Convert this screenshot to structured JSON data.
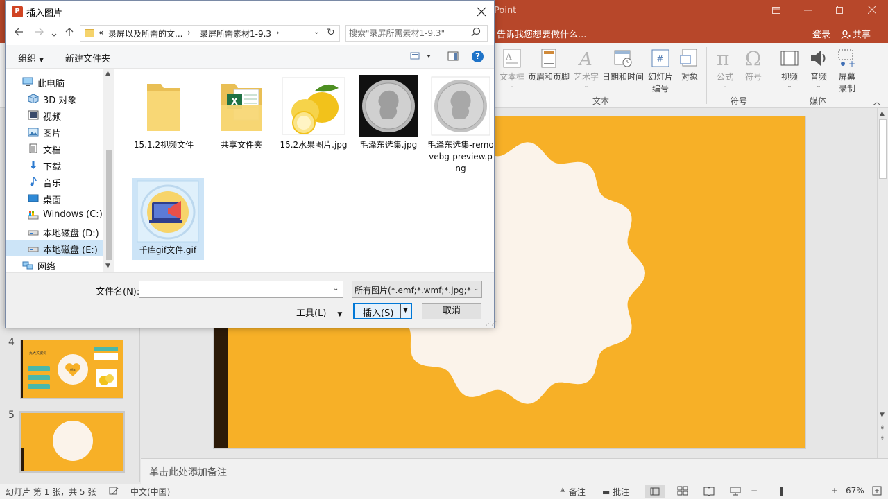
{
  "ppt": {
    "app_title_fragment": "Point",
    "tell_me": "告诉我您想要做什么...",
    "login": "登录",
    "share": "共享",
    "ribbon": {
      "text_box": "文本框",
      "header_footer": "页眉和页脚",
      "wordart": "艺术字",
      "date_time": "日期和时间",
      "slide_number_l1": "幻灯片",
      "slide_number_l2": "编号",
      "object": "对象",
      "equation": "公式",
      "symbol": "符号",
      "video": "视频",
      "audio": "音频",
      "screen_rec_l1": "屏幕",
      "screen_rec_l2": "录制",
      "group_text": "文本",
      "group_symbols": "符号",
      "group_media": "媒体"
    },
    "slides": {
      "num4": "4",
      "num5": "5",
      "thumb4_text": "九大关键词",
      "thumb4_heart": "新年"
    },
    "notes_placeholder": "单击此处添加备注",
    "status": {
      "slide_info": "幻灯片 第 1 张，共 5 张",
      "language": "中文(中国)",
      "notes": "备注",
      "comments": "批注",
      "zoom": "67%"
    }
  },
  "dialog": {
    "title": "插入图片",
    "logo": "P",
    "address": {
      "prefix": "«",
      "seg1": "录屏以及所需的文...",
      "seg2": "录屏所需素材1-9.3"
    },
    "search_placeholder": "搜索\"录屏所需素材1-9.3\"",
    "toolbar": {
      "organize": "组织",
      "new_folder": "新建文件夹"
    },
    "tree": [
      {
        "label": "此电脑",
        "icon": "pc-icon"
      },
      {
        "label": "3D 对象",
        "icon": "cube-icon"
      },
      {
        "label": "视频",
        "icon": "video-folder-icon"
      },
      {
        "label": "图片",
        "icon": "picture-folder-icon"
      },
      {
        "label": "文档",
        "icon": "document-folder-icon"
      },
      {
        "label": "下载",
        "icon": "download-icon"
      },
      {
        "label": "音乐",
        "icon": "music-icon"
      },
      {
        "label": "桌面",
        "icon": "desktop-icon"
      },
      {
        "label": "Windows (C:)",
        "icon": "system-drive-icon"
      },
      {
        "label": "本地磁盘 (D:)",
        "icon": "drive-icon"
      },
      {
        "label": "本地磁盘 (E:)",
        "icon": "drive-icon"
      },
      {
        "label": "网络",
        "icon": "network-icon"
      }
    ],
    "files": [
      {
        "name": "15.1.2视频文件",
        "kind": "folder"
      },
      {
        "name": "共享文件夹",
        "kind": "folder-excel"
      },
      {
        "name": "15.2水果图片.jpg",
        "kind": "lemon"
      },
      {
        "name": "毛泽东选集.jpg",
        "kind": "coin-dark"
      },
      {
        "name": "毛泽东选集-removebg-preview.png",
        "kind": "coin-light"
      },
      {
        "name": "千库gif文件.gif",
        "kind": "gif"
      }
    ],
    "filename_label": "文件名(N):",
    "filename_value": "",
    "filetype": "所有图片(*.emf;*.wmf;*.jpg;*.jpeg;*.png)",
    "tools": "工具(L)",
    "insert": "插入(S)",
    "cancel": "取消"
  },
  "colors": {
    "ppt_accent": "#b7472a",
    "slide_bg": "#f7b027",
    "selection": "#cce4f7",
    "primary_button_border": "#0078d7"
  }
}
